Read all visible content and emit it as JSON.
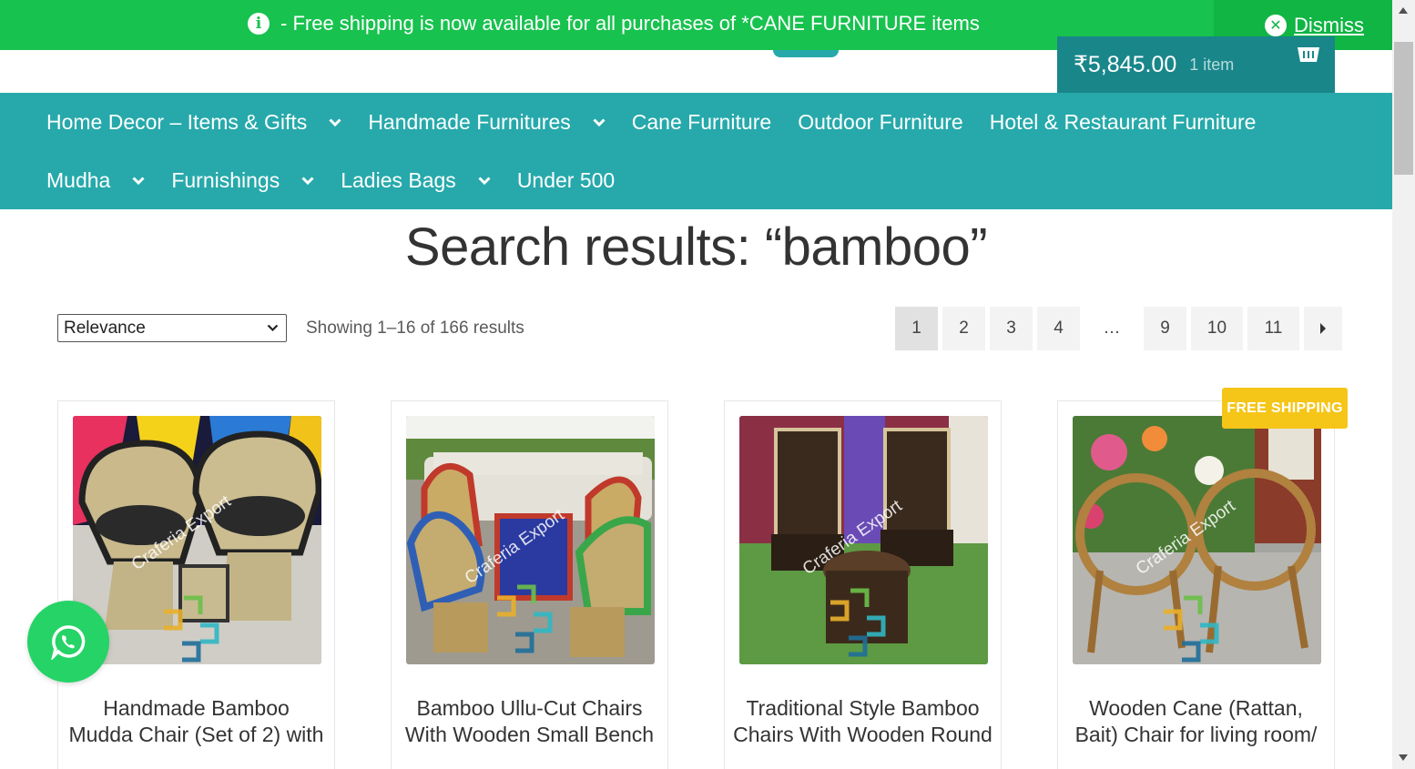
{
  "notice": {
    "message": "- Free shipping is now available for all purchases of *CANE FURNITURE items",
    "info_glyph": "i",
    "dismiss_label": "Dismiss",
    "close_glyph": "✕"
  },
  "cart": {
    "amount": "₹5,845.00",
    "count": "1 item"
  },
  "nav": {
    "row1": [
      {
        "label": "Home Decor – Items & Gifts",
        "dropdown": true
      },
      {
        "label": "Handmade Furnitures",
        "dropdown": true
      },
      {
        "label": "Cane Furniture",
        "dropdown": false
      },
      {
        "label": "Outdoor Furniture",
        "dropdown": false
      },
      {
        "label": "Hotel & Restaurant Furniture",
        "dropdown": false
      }
    ],
    "row2": [
      {
        "label": "Mudha",
        "dropdown": true
      },
      {
        "label": "Furnishings",
        "dropdown": true
      },
      {
        "label": "Ladies Bags",
        "dropdown": true
      },
      {
        "label": "Under 500",
        "dropdown": false
      }
    ]
  },
  "page_title": "Search results: “bamboo”",
  "sort": {
    "selected": "Relevance"
  },
  "result_count": "Showing 1–16 of 166 results",
  "pagination": [
    "1",
    "2",
    "3",
    "4",
    "…",
    "9",
    "10",
    "11"
  ],
  "pagination_current": "1",
  "badge": "FREE SHIPPING",
  "products": [
    {
      "name_line1": "Handmade Bamboo",
      "name_line2": "Mudda Chair (Set of 2) with"
    },
    {
      "name_line1": "Bamboo Ullu-Cut Chairs",
      "name_line2": "With Wooden Small Bench"
    },
    {
      "name_line1": "Traditional Style Bamboo",
      "name_line2": "Chairs With Wooden Round"
    },
    {
      "name_line1": "Wooden Cane (Rattan,",
      "name_line2": "Bait) Chair for living room/"
    }
  ],
  "watermark": "Craferia Export",
  "colors": {
    "notice_green": "#18c24f",
    "nav_teal": "#27a9ab",
    "cart_teal": "#19868a",
    "badge_yellow": "#f5c518",
    "whatsapp_green": "#25d366"
  }
}
